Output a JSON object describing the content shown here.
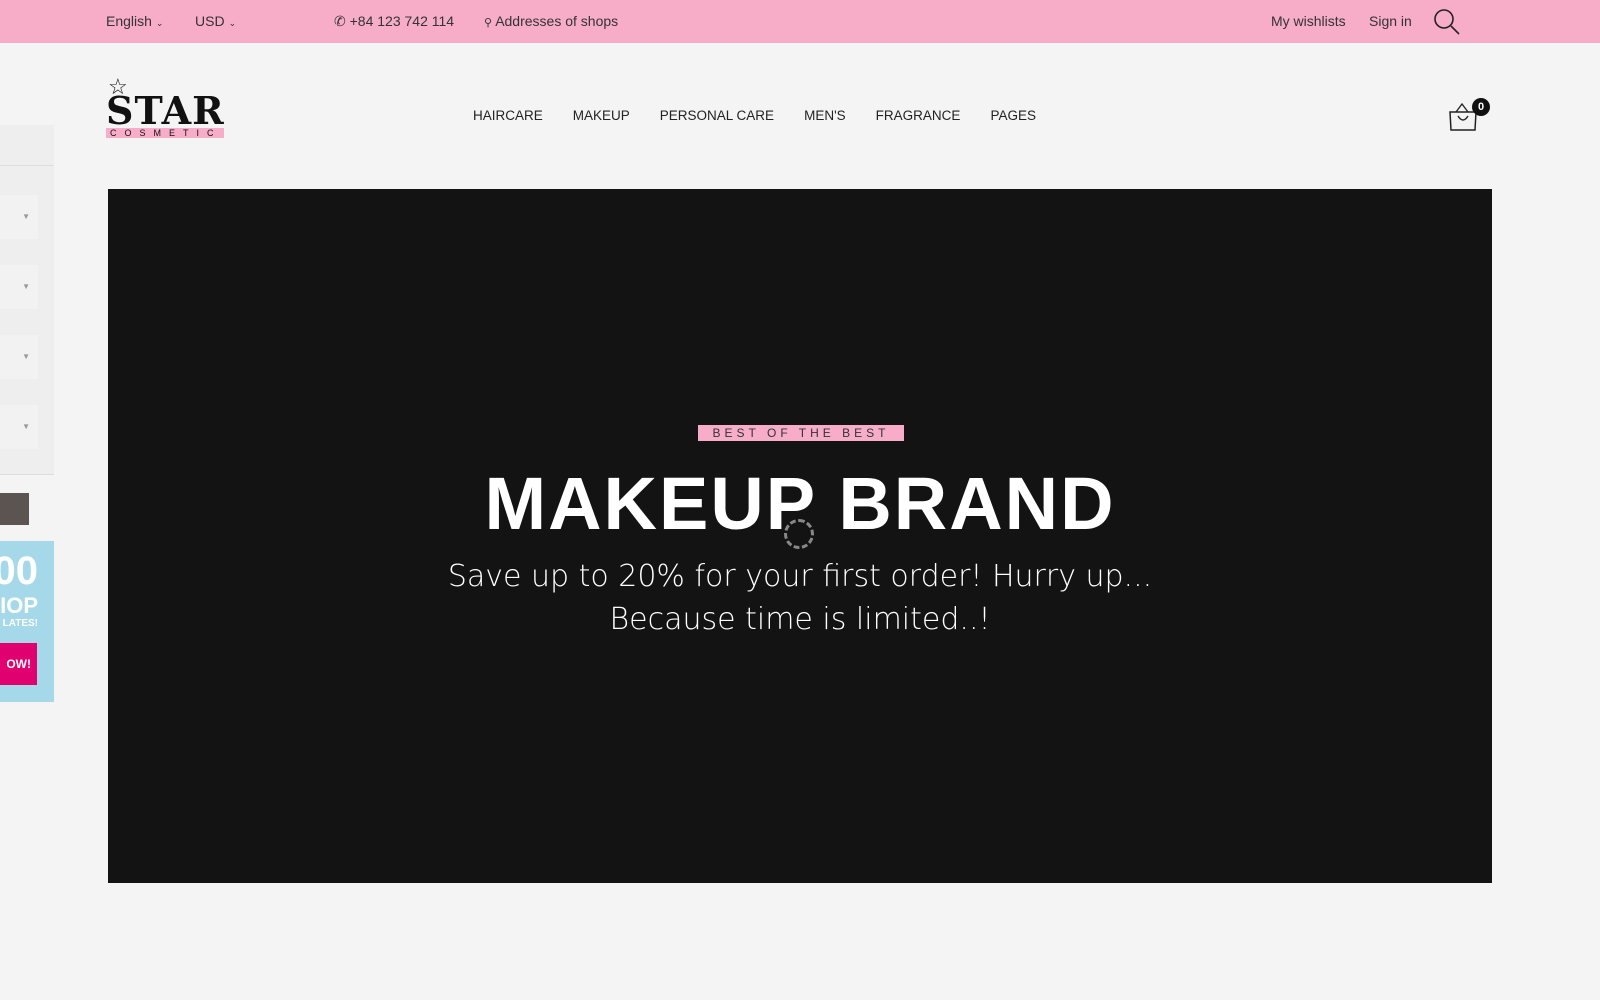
{
  "topbar": {
    "language": "English",
    "currency": "USD",
    "phone": "+84 123 742 114",
    "addresses": "Addresses of shops",
    "wishlists": "My wishlists",
    "signin": "Sign in"
  },
  "logo": {
    "word": "STAR",
    "sub": "COSMETIC"
  },
  "nav": [
    "HAIRCARE",
    "MAKEUP",
    "PERSONAL CARE",
    "MEN'S",
    "FRAGRANCE",
    "PAGES"
  ],
  "cart": {
    "count": "0"
  },
  "hero": {
    "tag": "BEST OF THE BEST",
    "title": "MAKEUP BRAND",
    "line1": "Save up to 20% for your first order! Hurry up...",
    "line2": "Because time is limited..!"
  },
  "side_promo": {
    "l1": "00",
    "l2": "IOP",
    "l3": "LATES!",
    "button": "OW!"
  },
  "colors": {
    "topbar": "#f7adc8",
    "hero_bg": "#131313",
    "promo_bg": "#a5d9ea",
    "promo_button": "#e0006f"
  }
}
